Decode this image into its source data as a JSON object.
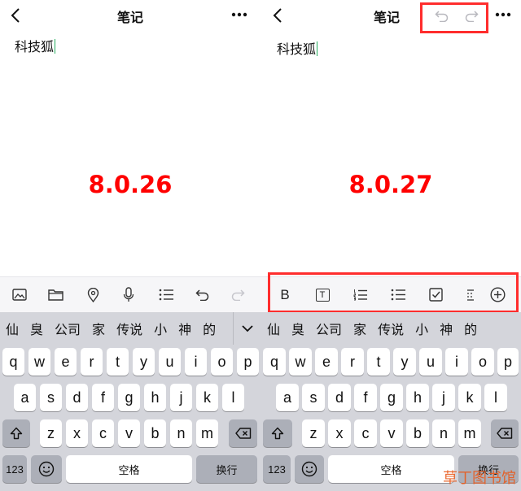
{
  "left": {
    "nav_title": "笔记",
    "note_text": "科技狐",
    "version": "8.0.26",
    "toolbar_icons": [
      "image-icon",
      "folder-icon",
      "location-icon",
      "microphone-icon",
      "list-icon",
      "undo-icon",
      "redo-icon"
    ]
  },
  "right": {
    "nav_title": "笔记",
    "note_text": "科技狐",
    "version": "8.0.27",
    "toolbar": {
      "bold_label": "B",
      "text_icon_label": "T"
    }
  },
  "keyboard": {
    "candidates": [
      "仙",
      "臭",
      "公司",
      "家",
      "传说",
      "小",
      "神",
      "的"
    ],
    "row1": [
      "q",
      "w",
      "e",
      "r",
      "t",
      "y",
      "u",
      "i",
      "o",
      "p"
    ],
    "row2": [
      "a",
      "s",
      "d",
      "f",
      "g",
      "h",
      "j",
      "k",
      "l"
    ],
    "row3": [
      "z",
      "x",
      "c",
      "v",
      "b",
      "n",
      "m"
    ],
    "num_label": "123",
    "space_label": "空格",
    "return_label": "换行"
  },
  "watermark": "草丁图书馆",
  "colors": {
    "highlight": "#ff2d2d",
    "version": "#ff0000",
    "caret": "#27ae60"
  }
}
